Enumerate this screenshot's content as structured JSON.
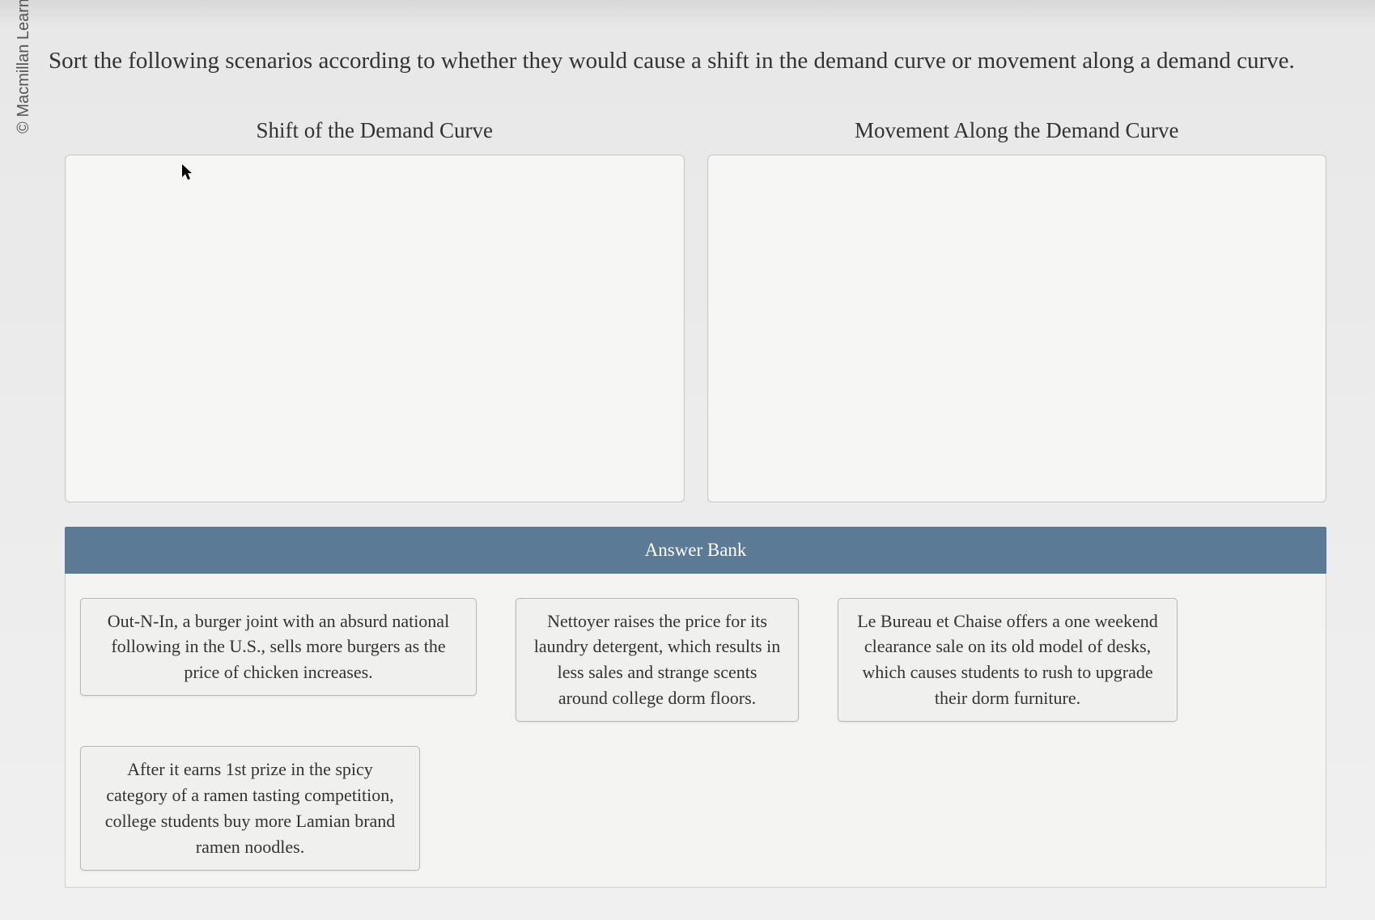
{
  "copyright": "© Macmillan Learning",
  "question": "Sort the following scenarios according to whether they would cause a shift in the demand curve or movement along a demand curve.",
  "dropzones": {
    "left_title": "Shift of the Demand Curve",
    "right_title": "Movement Along the Demand Curve"
  },
  "answer_bank_label": "Answer Bank",
  "answers": {
    "item1": "Out-N-In, a burger joint with an absurd national following in the U.S., sells more burgers as the price of chicken increases.",
    "item2": "Nettoyer raises the price for its laundry detergent, which results in less sales and strange scents around college dorm floors.",
    "item3": "Le Bureau et Chaise offers a one weekend clearance sale on its old model of desks, which causes students to rush to upgrade their dorm furniture.",
    "item4": "After it earns 1st prize in the spicy category of a ramen tasting competition, college students buy more Lamian brand ramen noodles."
  }
}
